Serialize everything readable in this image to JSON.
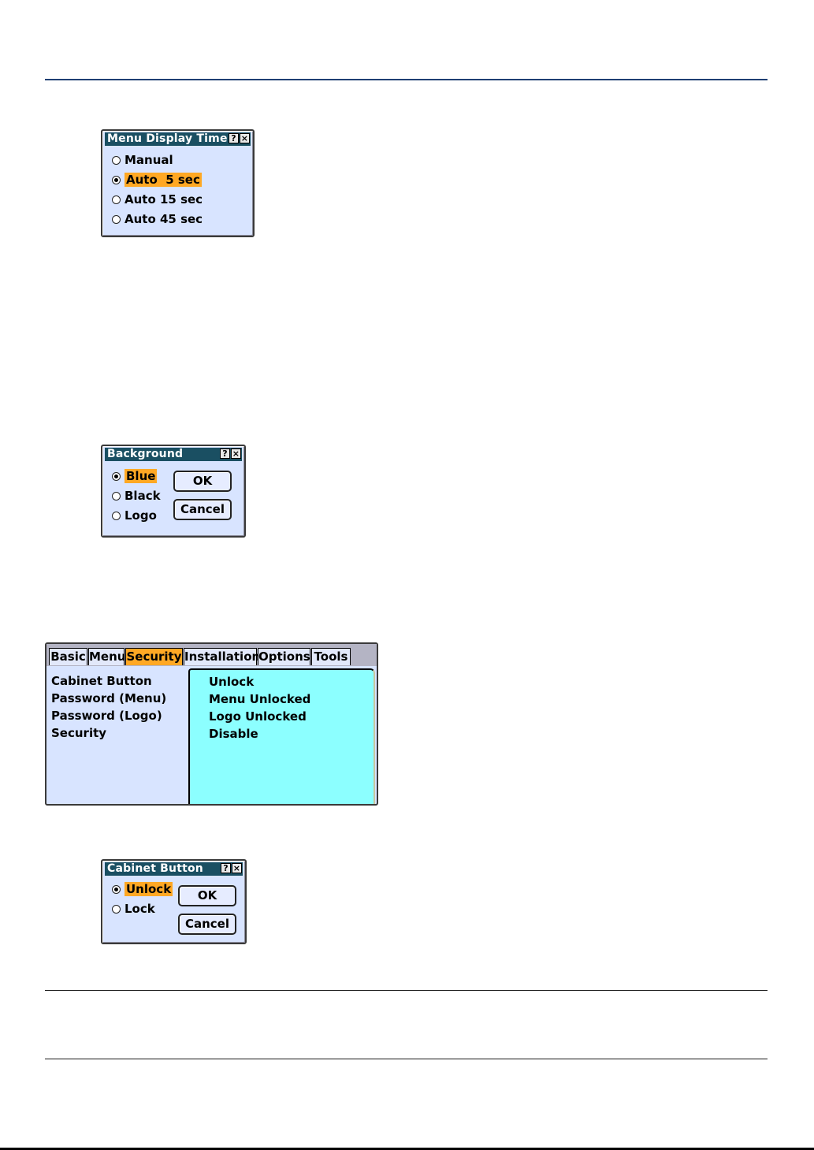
{
  "menu_display_time": {
    "title": "Menu Display Time",
    "help": "?",
    "close": "×",
    "options": [
      "Manual",
      "Auto  5 sec",
      "Auto 15 sec",
      "Auto 45 sec"
    ],
    "selected": 1
  },
  "background": {
    "title": "Background",
    "help": "?",
    "close": "×",
    "options": [
      "Blue",
      "Black",
      "Logo"
    ],
    "selected": 0,
    "ok_label": "OK",
    "cancel_label": "Cancel"
  },
  "menu": {
    "tabs": [
      "Basic",
      "Menu",
      "Security",
      "Installation",
      "Options",
      "Tools"
    ],
    "active_tab": 2,
    "items": [
      "Cabinet Button",
      "Password (Menu)",
      "Password (Logo)",
      "Security"
    ],
    "values": [
      "Unlock",
      "Menu Unlocked",
      "Logo Unlocked",
      "Disable"
    ]
  },
  "cabinet_button": {
    "title": "Cabinet Button",
    "help": "?",
    "close": "×",
    "options": [
      "Unlock",
      "Lock"
    ],
    "selected": 0,
    "ok_label": "OK",
    "cancel_label": "Cancel"
  },
  "colors": {
    "title_bar": "#1a4f62",
    "dialog_bg": "#d8e4ff",
    "highlight": "#ffa824",
    "value_pane": "#8cffff"
  }
}
